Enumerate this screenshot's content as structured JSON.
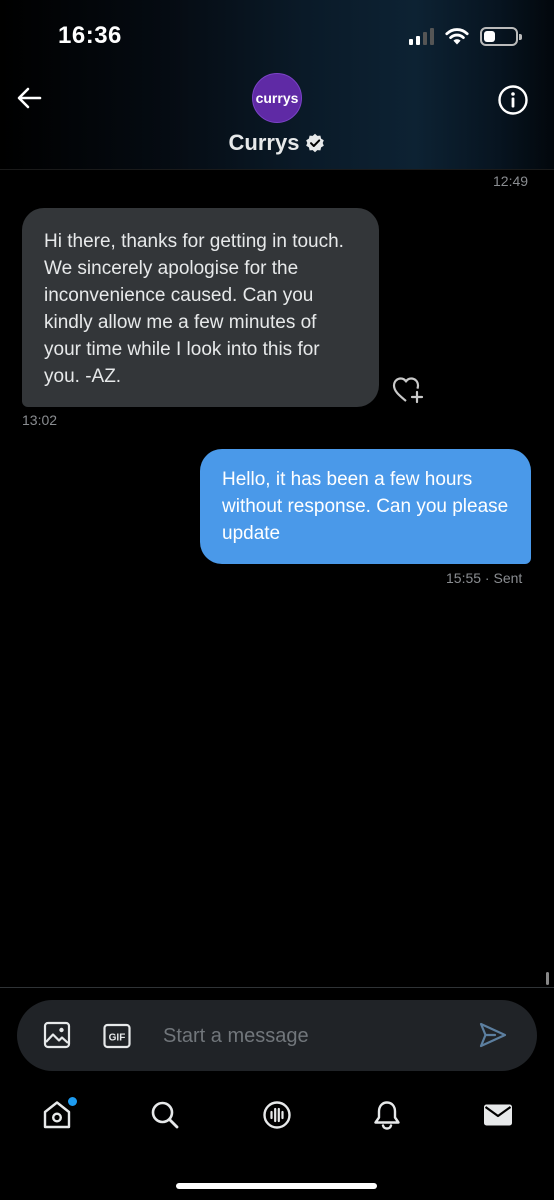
{
  "status_bar": {
    "time": "16:36",
    "battery_level": 0.35
  },
  "header": {
    "avatar_text": "currys",
    "name": "Currys",
    "verified": true
  },
  "conversation": {
    "top_timestamp": "12:49",
    "messages": [
      {
        "direction": "received",
        "text": "Hi there, thanks for getting in touch. We sincerely apologise for the inconvenience caused. Can you kindly allow me a few minutes of your time while I look into this for you. -AZ.",
        "timestamp": "13:02"
      },
      {
        "direction": "sent",
        "text": "Hello, it has been a few hours without response. Can you please update",
        "timestamp": "15:55 · Sent"
      }
    ]
  },
  "composer": {
    "placeholder": "Start a message",
    "gif_label": "GIF"
  },
  "tabs": [
    "home-icon",
    "search-icon",
    "spaces-icon",
    "notifications-icon",
    "messages-icon"
  ],
  "colors": {
    "accent": "#1d9bf0",
    "sent_bubble": "#4a99e9",
    "received_bubble": "#333639",
    "brand": "#5f2aa5"
  }
}
